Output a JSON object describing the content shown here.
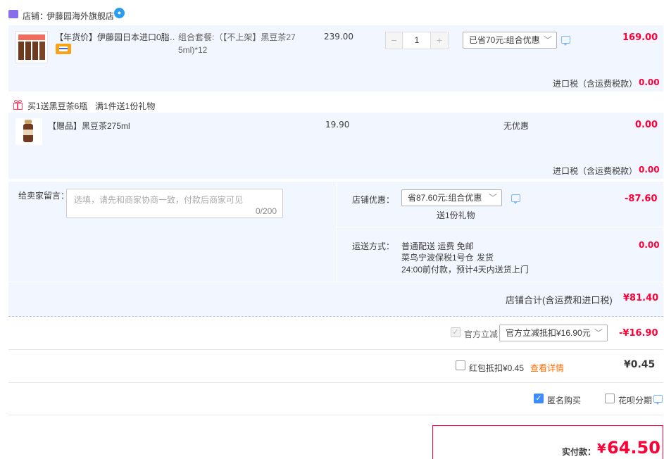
{
  "shop": {
    "label": "店铺：",
    "name": "伊藤园海外旗舰店"
  },
  "item1": {
    "title": "【年货价】伊藤园日本进口0脂…",
    "sku": "组合套餐:（【不上架】黑豆茶275ml)*12",
    "unit_price": "239.00",
    "qty_minus": "−",
    "qty": "1",
    "qty_plus": "+",
    "promo_select": "已省70元:组合优惠",
    "subtotal": "169.00",
    "tax_label": "进口税（含运费税款）",
    "tax_value": "0.00"
  },
  "gift_banner": {
    "text": "买1送黑豆茶6瓶",
    "rule": "满1件送1份礼物"
  },
  "item2": {
    "title": "【赠品】黑豆茶275ml",
    "unit_price": "19.90",
    "discount": "无优惠",
    "subtotal": "0.00",
    "tax_label": "进口税（含运费税款）",
    "tax_value": "0.00"
  },
  "message": {
    "label": "给卖家留言：",
    "placeholder": "选填，请先和商家协商一致，付款后商家可见",
    "counter": "0/200"
  },
  "shop_discount": {
    "label": "店铺优惠：",
    "select": "省87.60元:组合优惠",
    "note": "送1份礼物",
    "value": "-87.60"
  },
  "shipping": {
    "label": "运送方式：",
    "method": "普通配送 运费 免邮",
    "warehouse": "菜鸟宁波保税1号仓",
    "ship": "发货",
    "eta": "24:00前付款，预计4天内送货上门",
    "value": "0.00"
  },
  "shop_total": {
    "label": "店铺合计(含运费和进口税)",
    "value": "¥81.40"
  },
  "official": {
    "label": "官方立减",
    "select": "官方立减抵扣¥16.90元",
    "value": "-¥16.90"
  },
  "redpacket": {
    "label": "红包抵扣¥0.45",
    "link": "查看详情",
    "value": "¥0.45"
  },
  "options": {
    "anonymous": "匿名购买",
    "huabei": "花呗分期"
  },
  "pay": {
    "label": "实付款：",
    "currency": "¥",
    "value": "64.50"
  },
  "colors": {
    "accent_red": "#ff0036",
    "band_blue": "#f2f7ff",
    "link_blue": "#3b8cff"
  }
}
